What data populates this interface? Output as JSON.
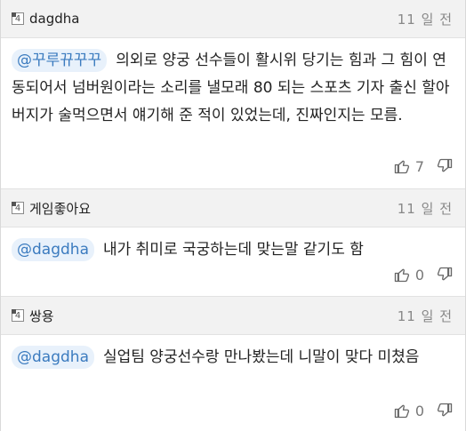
{
  "comments": [
    {
      "author": "dagdha",
      "time": "11 일 전",
      "mention": "@꾸루뀨꾸꾸",
      "text": "의외로 양궁 선수들이 활시위 당기는 힘과 그 힘이 연동되어서 넘버원이라는 소리를 낼모래 80 되는 스포츠 기자 출신 할아버지가 술먹으면서 얘기해 준 적이 있었는데, 진짜인지는 모름.",
      "likes": "7"
    },
    {
      "author": "게임좋아요",
      "time": "11 일 전",
      "mention": "@dagdha",
      "text": "내가 취미로 국궁하는데 맞는말 같기도 함",
      "likes": "0"
    },
    {
      "author": "쌍용",
      "time": "11 일 전",
      "mention": "@dagdha",
      "text": "실업팀 양궁선수랑 만나봤는데 니말이 맞다 미쳤음",
      "likes": "0"
    }
  ]
}
